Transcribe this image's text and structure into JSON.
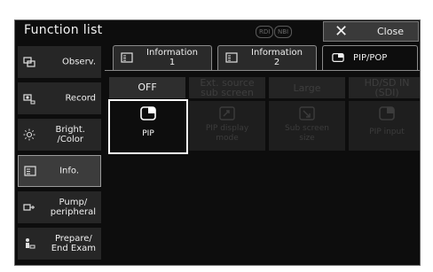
{
  "window": {
    "title": "Function list",
    "badges": [
      "RDI",
      "NBI"
    ],
    "close_label": "Close"
  },
  "sidebar": {
    "items": [
      {
        "label": "Observ.",
        "icon": "observation-icon",
        "active": false
      },
      {
        "label": "Record",
        "icon": "record-icon",
        "active": false
      },
      {
        "label": "Bright.\n/Color",
        "icon": "brightness-icon",
        "active": false
      },
      {
        "label": "Info.",
        "icon": "info-icon",
        "active": true
      },
      {
        "label": "Pump/\nperipheral",
        "icon": "pump-icon",
        "active": false
      },
      {
        "label": "Prepare/\nEnd Exam",
        "icon": "prepare-icon",
        "active": false
      }
    ]
  },
  "tabs": [
    {
      "label": "Information\n1",
      "active": false
    },
    {
      "label": "Information\n2",
      "active": false
    },
    {
      "label": "PIP/POP",
      "active": true
    }
  ],
  "pip": {
    "headers": [
      {
        "label": "OFF",
        "enabled": true
      },
      {
        "label": "Ext. source\nsub screen",
        "enabled": false
      },
      {
        "label": "Large",
        "enabled": false
      },
      {
        "label": "HD/SD IN\n(SDI)",
        "enabled": false
      }
    ],
    "options": [
      {
        "label": "PIP",
        "icon": "pip-icon",
        "selected": true
      },
      {
        "label": "PIP display\nmode",
        "icon": "pip-display-mode-icon",
        "selected": false
      },
      {
        "label": "Sub screen\nsize",
        "icon": "sub-screen-size-icon",
        "selected": false
      },
      {
        "label": "PIP input",
        "icon": "pip-input-icon",
        "selected": false
      }
    ]
  },
  "colors": {
    "background": "#0d0d0d",
    "active_text": "#f0f0f0",
    "disabled_text": "#3e3e3e",
    "selection_border": "#ffffff"
  }
}
